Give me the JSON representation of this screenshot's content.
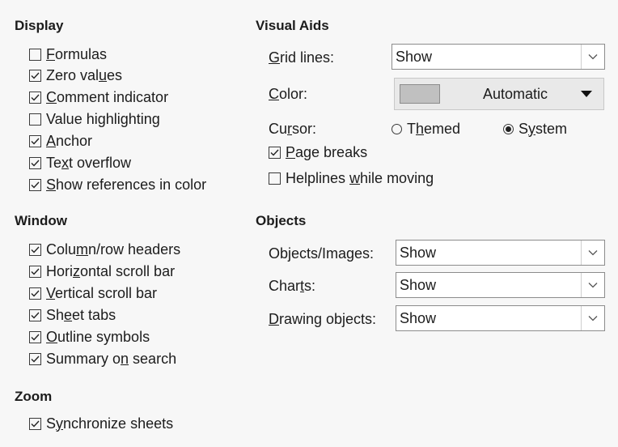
{
  "display": {
    "title": "Display",
    "options": [
      {
        "pre": "",
        "u": "F",
        "post": "ormulas",
        "checked": false
      },
      {
        "pre": "Zero val",
        "u": "u",
        "post": "es",
        "checked": true
      },
      {
        "pre": "",
        "u": "C",
        "post": "omment indicator",
        "checked": true
      },
      {
        "pre": "Value hi",
        "u": "g",
        "post": "hlighting",
        "checked": false
      },
      {
        "pre": "",
        "u": "A",
        "post": "nchor",
        "checked": true
      },
      {
        "pre": "Te",
        "u": "x",
        "post": "t overflow",
        "checked": true
      },
      {
        "pre": "",
        "u": "S",
        "post": "how references in color",
        "checked": true
      }
    ]
  },
  "window": {
    "title": "Window",
    "options": [
      {
        "pre": "Colu",
        "u": "m",
        "post": "n/row headers",
        "checked": true
      },
      {
        "pre": "Hori",
        "u": "z",
        "post": "ontal scroll bar",
        "checked": true
      },
      {
        "pre": "",
        "u": "V",
        "post": "ertical scroll bar",
        "checked": true
      },
      {
        "pre": "Sh",
        "u": "e",
        "post": "et tabs",
        "checked": true
      },
      {
        "pre": "",
        "u": "O",
        "post": "utline symbols",
        "checked": true
      },
      {
        "pre": "Summary o",
        "u": "n",
        "post": " search",
        "checked": true
      }
    ]
  },
  "zoom": {
    "title": "Zoom",
    "options": [
      {
        "pre": "S",
        "u": "y",
        "post": "nchronize sheets",
        "checked": true
      }
    ]
  },
  "visual_aids": {
    "title": "Visual Aids",
    "grid_lines": {
      "pre": "",
      "u": "G",
      "post": "rid lines:",
      "value": "Show"
    },
    "color": {
      "pre": "",
      "u": "C",
      "post": "olor:",
      "value": "Automatic",
      "swatch": "#c0c0c0"
    },
    "cursor": {
      "pre": "Cu",
      "u": "r",
      "post": "sor:",
      "themed": {
        "pre": "T",
        "u": "h",
        "post": "emed",
        "selected": false
      },
      "system": {
        "pre": "S",
        "u": "y",
        "post": "stem",
        "selected": true
      }
    },
    "page_breaks": {
      "pre": "",
      "u": "P",
      "post": "age breaks",
      "checked": true
    },
    "helplines": {
      "pre": "Helplines ",
      "u": "w",
      "post": "hile moving",
      "checked": false
    }
  },
  "objects": {
    "title": "Objects",
    "rows": [
      {
        "pre": "Ob",
        "u": "j",
        "post": "ects/Images:",
        "value": "Show"
      },
      {
        "pre": "Char",
        "u": "t",
        "post": "s:",
        "value": "Show"
      },
      {
        "pre": "",
        "u": "D",
        "post": "rawing objects:",
        "value": "Show"
      }
    ]
  }
}
